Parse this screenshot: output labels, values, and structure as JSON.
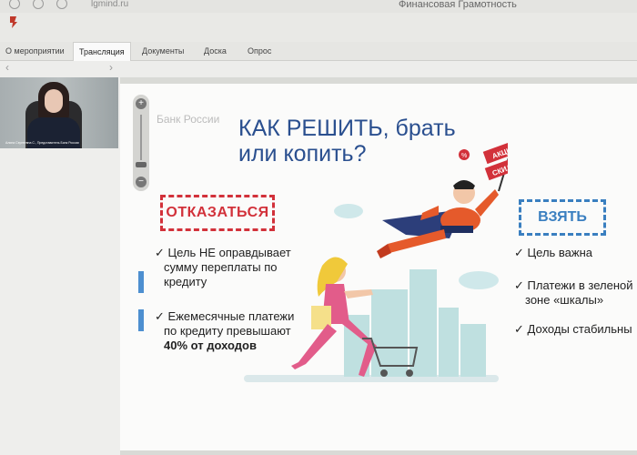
{
  "browser": {
    "url": "lgmind.ru",
    "window_title": "Финансовая Грамотность"
  },
  "tabs": [
    {
      "label": "О мероприятии"
    },
    {
      "label": "Трансляция"
    },
    {
      "label": "Документы"
    },
    {
      "label": "Доска"
    },
    {
      "label": "Опрос"
    }
  ],
  "subbar": {
    "prev_icon": "chevron-left-icon",
    "next_icon": "chevron-right-icon"
  },
  "video": {
    "caption": "Алина Сергеевна С., Представитель Банк России"
  },
  "slide": {
    "logo": "Банк России",
    "title_line1": "КАК РЕШИТЬ, брать",
    "title_line2": "или копить?",
    "refuse": {
      "label": "ОТКАЗАТЬСЯ",
      "items": [
        {
          "mark": "✓",
          "lines": [
            "Цель НЕ оправдывает",
            "сумму переплаты по",
            "кредиту"
          ]
        },
        {
          "mark": "✓",
          "lines": [
            "Ежемесячные платежи",
            "по кредиту превышают"
          ],
          "bold": "40% от доходов"
        }
      ]
    },
    "take": {
      "label": "ВЗЯТЬ",
      "items": [
        {
          "mark": "✓",
          "lines": [
            "Цель важна"
          ]
        },
        {
          "mark": "✓",
          "lines": [
            "Платежи в зеленой",
            "зоне «шкалы»"
          ]
        },
        {
          "mark": "✓",
          "lines": [
            "Доходы стабильны"
          ]
        }
      ]
    },
    "sign": {
      "top": "АКЦИИ",
      "bottom": "СКИДКИ",
      "percent": "%"
    }
  },
  "colors": {
    "title": "#2a4f8f",
    "refuse": "#d2313a",
    "take": "#3a7fc0",
    "green_accent": "#8fcf8f",
    "blue_accent": "#4d8fd0"
  }
}
